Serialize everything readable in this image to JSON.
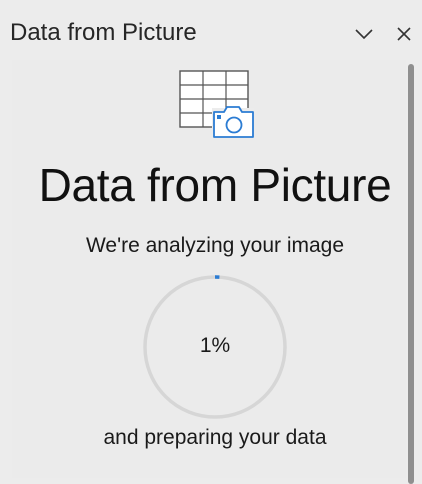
{
  "pane": {
    "title": "Data from Picture"
  },
  "main": {
    "hero_icon": "table-camera-icon",
    "title": "Data from Picture",
    "status": "We're analyzing your image",
    "progress_label": "1%",
    "progress_value": 0.01,
    "footer": "and preparing your data"
  },
  "colors": {
    "accent": "#2b7cd3",
    "ring_track": "#d6d6d6",
    "background": "#ececec"
  }
}
